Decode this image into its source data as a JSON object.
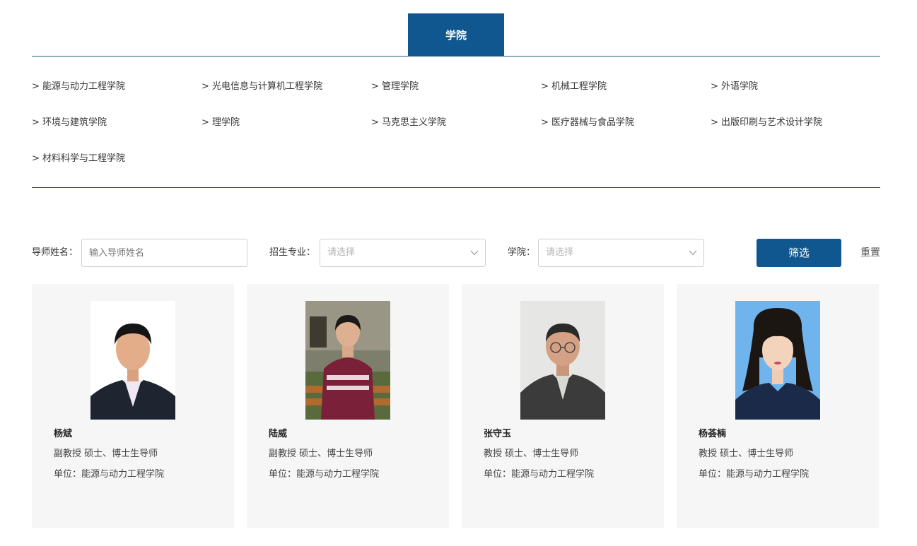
{
  "tab": {
    "label": "学院"
  },
  "colleges": [
    "> 能源与动力工程学院",
    "> 光电信息与计算机工程学院",
    "> 管理学院",
    "> 机械工程学院",
    "> 外语学院",
    "> 环境与建筑学院",
    "> 理学院",
    "> 马克思主义学院",
    "> 医疗器械与食品学院",
    "> 出版印刷与艺术设计学院",
    "> 材料科学与工程学院"
  ],
  "filter": {
    "name_label": "导师姓名：",
    "name_placeholder": "输入导师姓名",
    "major_label": "招生专业：",
    "major_placeholder": "请选择",
    "college_label": "学院：",
    "college_placeholder": "请选择",
    "filter_button": "筛选",
    "reset_button": "重置"
  },
  "advisors": [
    {
      "name": "杨斌",
      "title": "副教授 硕士、博士生导师",
      "unit": "单位：能源与动力工程学院",
      "photo_bg": "#ffffff"
    },
    {
      "name": "陆威",
      "title": "副教授 硕士、博士生导师",
      "unit": "单位：能源与动力工程学院",
      "photo_bg": "#8a8a78"
    },
    {
      "name": "张守玉",
      "title": "教授 硕士、博士生导师",
      "unit": "单位：能源与动力工程学院",
      "photo_bg": "#e8e8e8"
    },
    {
      "name": "杨荟楠",
      "title": "教授 硕士、博士生导师",
      "unit": "单位：能源与动力工程学院",
      "photo_bg": "#6fb4ec"
    }
  ],
  "colors": {
    "accent": "#10568f",
    "divider": "#1a5a7a",
    "card_bg": "#f6f6f6"
  }
}
